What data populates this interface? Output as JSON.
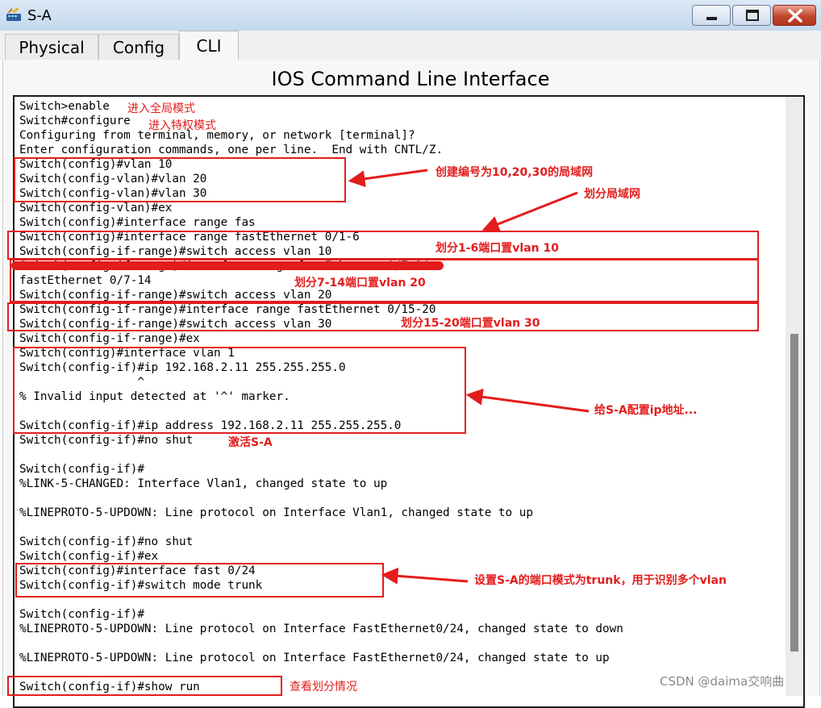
{
  "window": {
    "title": "S-A",
    "icon": "packet-tracer-switch-icon",
    "controls": [
      "minimize",
      "maximize",
      "close"
    ]
  },
  "tabs": [
    {
      "label": "Physical",
      "active": false
    },
    {
      "label": "Config",
      "active": false
    },
    {
      "label": "CLI",
      "active": true
    }
  ],
  "heading": "IOS Command Line Interface",
  "terminal": {
    "lines": [
      "Switch>enable",
      "Switch#configure",
      "Configuring from terminal, memory, or network [terminal]?",
      "Enter configuration commands, one per line.  End with CNTL/Z.",
      "Switch(config)#vlan 10",
      "Switch(config-vlan)#vlan 20",
      "Switch(config-vlan)#vlan 30",
      "Switch(config-vlan)#ex",
      "Switch(config)#interface range fas",
      "Switch(config)#interface range fastEthernet 0/1-6",
      "Switch(config-if-range)#switch access vlan 10",
      "Switch(config-if-range)#interface range fastEthernet 0/7-14",
      "fastEthernet 0/7-14",
      "Switch(config-if-range)#switch access vlan 20",
      "Switch(config-if-range)#interface range fastEthernet 0/15-20",
      "Switch(config-if-range)#switch access vlan 30",
      "Switch(config-if-range)#ex",
      "Switch(config)#interface vlan 1",
      "Switch(config-if)#ip 192.168.2.11 255.255.255.0",
      "                 ^",
      "% Invalid input detected at '^' marker.",
      "",
      "Switch(config-if)#ip address 192.168.2.11 255.255.255.0",
      "Switch(config-if)#no shut",
      "",
      "Switch(config-if)#",
      "%LINK-5-CHANGED: Interface Vlan1, changed state to up",
      "",
      "%LINEPROTO-5-UPDOWN: Line protocol on Interface Vlan1, changed state to up",
      "",
      "Switch(config-if)#no shut",
      "Switch(config-if)#ex",
      "Switch(config)#interface fast 0/24",
      "Switch(config-if)#switch mode trunk",
      "",
      "Switch(config-if)#",
      "%LINEPROTO-5-UPDOWN: Line protocol on Interface FastEthernet0/24, changed state to down",
      "",
      "%LINEPROTO-5-UPDOWN: Line protocol on Interface FastEthernet0/24, changed state to up",
      "",
      "Switch(config-if)#show run"
    ]
  },
  "annotations": {
    "enter_global_mode": "进入全局模式",
    "enter_privileged_mode": "进入特权模式",
    "create_vlans": "创建编号为10,20,30的局域网",
    "divide_lans": "划分局域网",
    "ports_1_6": "划分1-6端口置vlan 10",
    "ports_7_14": "划分7-14端口置vlan 20",
    "ports_15_20": "划分15-20端口置vlan 30",
    "config_ip": "给S-A配置ip地址...",
    "activate": "激活S-A",
    "trunk_mode": "设置S-A的端口模式为trunk，用于识别多个vlan",
    "show_division": "查看划分情况",
    "color": "#e41c1c"
  },
  "watermark": "CSDN @daima交响曲"
}
